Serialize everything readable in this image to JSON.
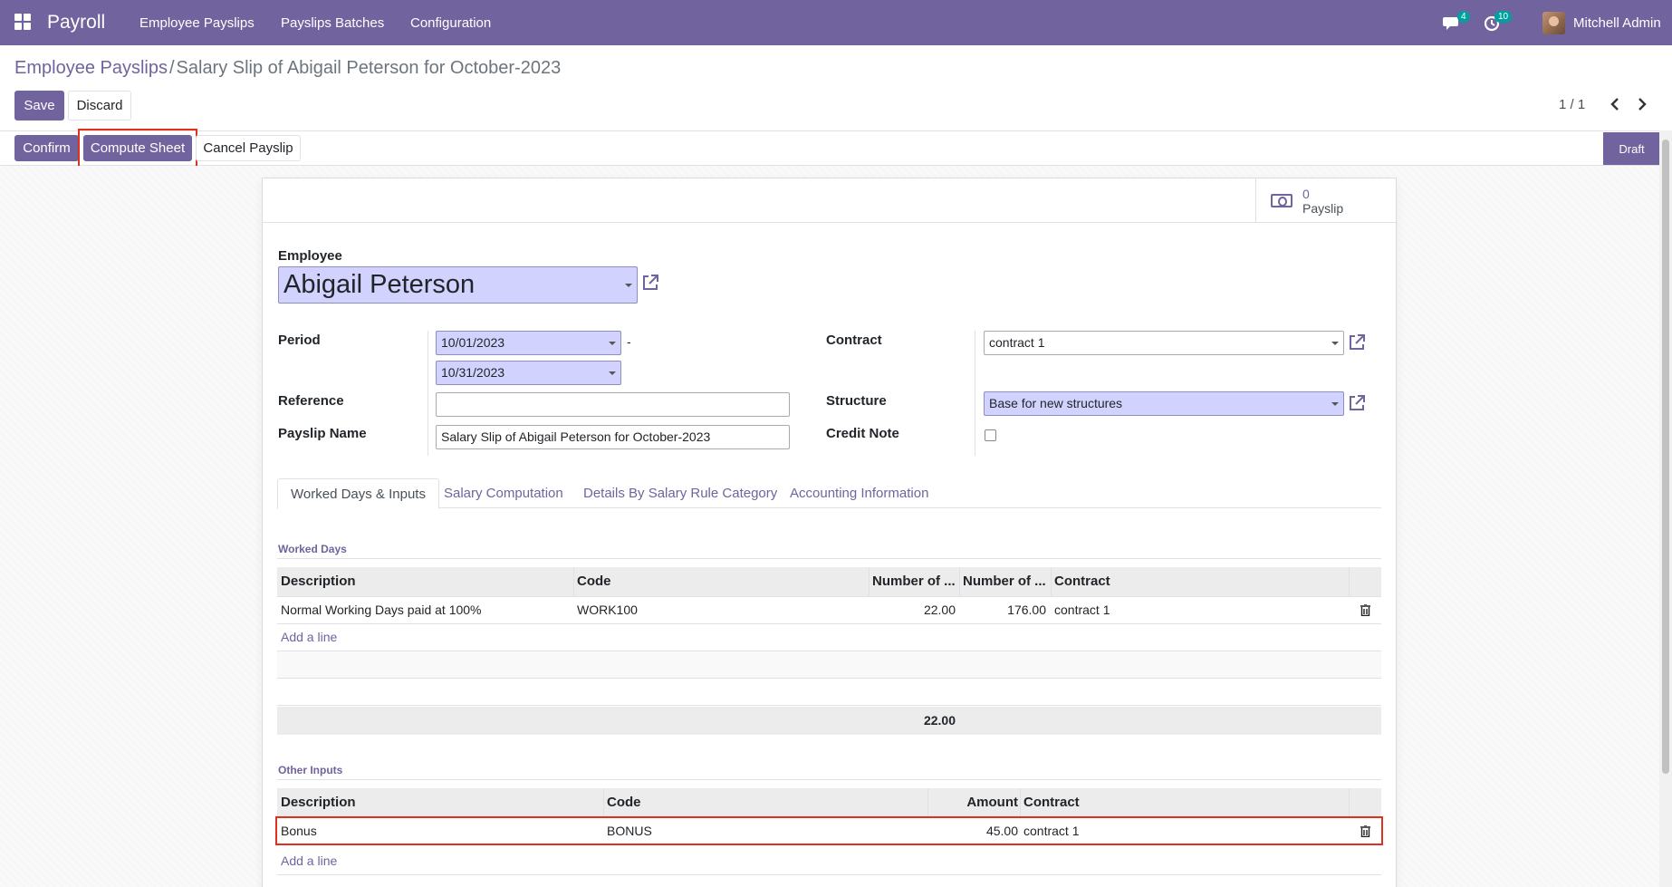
{
  "navbar": {
    "app_name": "Payroll",
    "menus": [
      "Employee Payslips",
      "Payslips Batches",
      "Configuration"
    ],
    "messages_count": "4",
    "activities_count": "10",
    "user_name": "Mitchell Admin"
  },
  "breadcrumb": {
    "parent": "Employee Payslips",
    "separator": "/",
    "current": "Salary Slip of Abigail Peterson for October-2023"
  },
  "control": {
    "save_label": "Save",
    "discard_label": "Discard",
    "pager": "1 / 1"
  },
  "statusbar": {
    "confirm_label": "Confirm",
    "compute_label": "Compute Sheet",
    "cancel_label": "Cancel Payslip",
    "state": "Draft"
  },
  "smart_button": {
    "value": "0",
    "label": "Payslip"
  },
  "form": {
    "employee_label": "Employee",
    "employee_value": "Abigail Peterson",
    "period_label": "Period",
    "date_from": "10/01/2023",
    "date_sep": "-",
    "date_to": "10/31/2023",
    "reference_label": "Reference",
    "reference_value": "",
    "payslip_name_label": "Payslip Name",
    "payslip_name_value": "Salary Slip of Abigail Peterson for October-2023",
    "contract_label": "Contract",
    "contract_value": "contract 1",
    "structure_label": "Structure",
    "structure_value": "Base for new structures",
    "credit_note_label": "Credit Note",
    "credit_note_checked": false
  },
  "tabs": [
    "Worked Days & Inputs",
    "Salary Computation",
    "Details By Salary Rule Category",
    "Accounting Information"
  ],
  "worked_days": {
    "title": "Worked Days",
    "columns": [
      "Description",
      "Code",
      "Number of ...",
      "Number of ...",
      "Contract"
    ],
    "rows": [
      {
        "description": "Normal Working Days paid at 100%",
        "code": "WORK100",
        "days": "22.00",
        "hours": "176.00",
        "contract": "contract 1"
      }
    ],
    "add_line": "Add a line",
    "total_days": "22.00"
  },
  "other_inputs": {
    "title": "Other Inputs",
    "columns": [
      "Description",
      "Code",
      "Amount",
      "Contract"
    ],
    "rows": [
      {
        "description": "Bonus",
        "code": "BONUS",
        "amount": "45.00",
        "contract": "contract 1"
      }
    ],
    "add_line": "Add a line"
  },
  "colors": {
    "brand": "#71639e",
    "required_bg": "#d2d2ff",
    "highlight": "#e0301e",
    "badge": "#00a09d"
  }
}
